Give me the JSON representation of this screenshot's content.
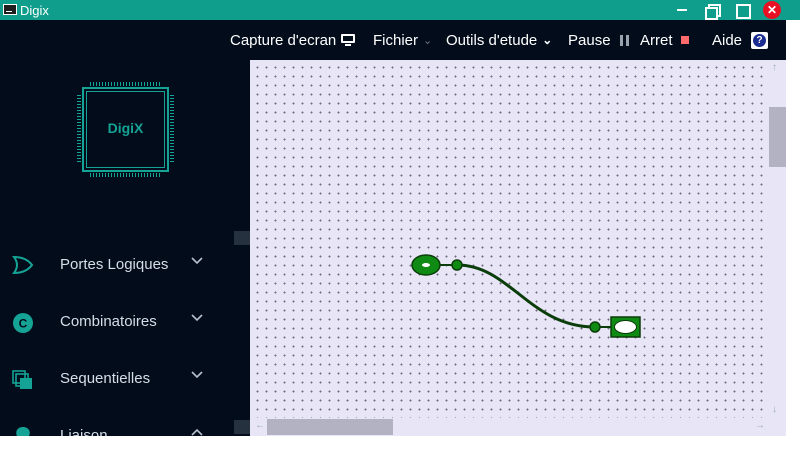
{
  "window": {
    "title": "Digix",
    "controls": {
      "minimize_icon": "minimize-icon",
      "restore_icon": "restore-icon",
      "maximize_icon": "maximize-icon",
      "close_glyph": "✕"
    }
  },
  "menubar": {
    "items": [
      {
        "label": "Capture d'ecran",
        "icon": "monitor-icon"
      },
      {
        "label": "Fichier",
        "icon": "chevron-down-icon"
      },
      {
        "label": "Outils d'etude",
        "icon": "chevron-down-icon"
      },
      {
        "label": "Pause",
        "icon": "pause-icon"
      },
      {
        "label": "Arret",
        "icon": "stop-icon"
      },
      {
        "label": "Aide",
        "icon": "help-icon",
        "glyph": "?"
      }
    ]
  },
  "sidebar": {
    "logo_text": "DigiX",
    "items": [
      {
        "label": "Portes Logiques",
        "icon": "or-gate-icon",
        "expanded": false
      },
      {
        "label": "Combinatoires",
        "icon": "c-circle-icon",
        "glyph": "C",
        "expanded": false
      },
      {
        "label": "Sequentielles",
        "icon": "stacked-squares-icon",
        "expanded": false
      },
      {
        "label": "Liaison",
        "icon": "lightbulb-icon",
        "expanded": true
      }
    ]
  },
  "colors": {
    "titlebar": "#0f9e8c",
    "dark_bg": "#020c1b",
    "accent": "#14a394",
    "canvas_bg": "#e8e6f6",
    "component_green": "#0f8a12",
    "wire": "#0b3d0b",
    "close_red": "#e81123",
    "stop_red": "#ff6b6b"
  }
}
